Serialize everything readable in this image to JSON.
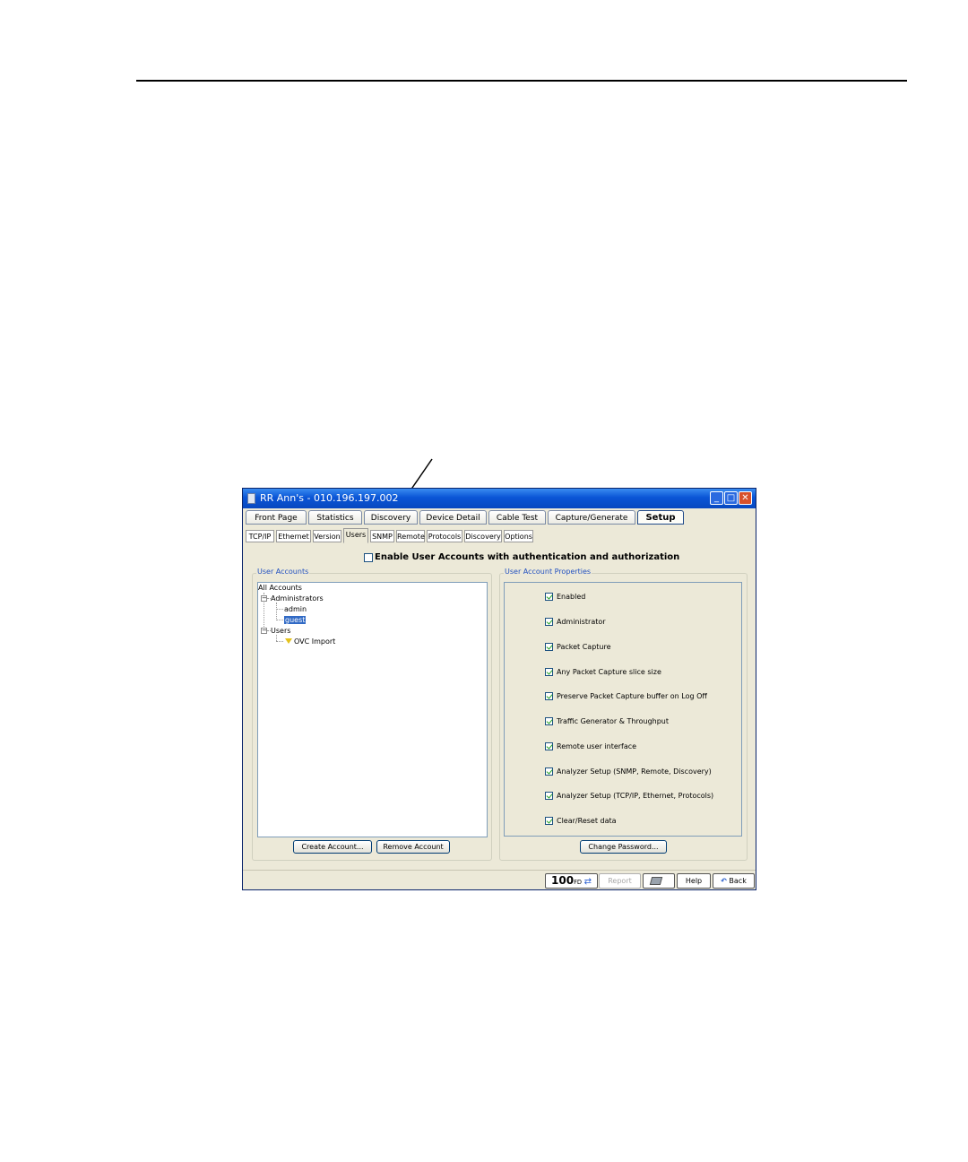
{
  "window": {
    "title": "RR Ann's - 010.196.197.002",
    "minimize_label": "_",
    "maximize_label": "□",
    "close_label": "✕"
  },
  "main_tabs": [
    {
      "label": "Front Page"
    },
    {
      "label": "Statistics"
    },
    {
      "label": "Discovery"
    },
    {
      "label": "Device Detail"
    },
    {
      "label": "Cable Test"
    },
    {
      "label": "Capture/Generate"
    },
    {
      "label": "Setup",
      "active": true
    }
  ],
  "sub_tabs": [
    {
      "label": "TCP/IP"
    },
    {
      "label": "Ethernet"
    },
    {
      "label": "Version"
    },
    {
      "label": "Users",
      "active": true
    },
    {
      "label": "SNMP"
    },
    {
      "label": "Remote"
    },
    {
      "label": "Protocols"
    },
    {
      "label": "Discovery"
    },
    {
      "label": "Options"
    }
  ],
  "enable_accounts": {
    "label": "Enable User Accounts with authentication and authorization",
    "checked": false
  },
  "user_accounts": {
    "legend": "User Accounts",
    "tree": {
      "root": "All Accounts",
      "administrators": "Administrators",
      "admin": "admin",
      "guest": "guest",
      "users": "Users",
      "ovc_import": "OVC Import"
    },
    "create_button": "Create Account...",
    "remove_button": "Remove Account"
  },
  "properties": {
    "legend": "User Account Properties",
    "items": [
      {
        "label": "Enabled",
        "checked": true
      },
      {
        "label": "Administrator",
        "checked": true
      },
      {
        "label": "Packet Capture",
        "checked": true
      },
      {
        "label": "Any Packet Capture slice size",
        "checked": true
      },
      {
        "label": "Preserve Packet Capture buffer on Log Off",
        "checked": true
      },
      {
        "label": "Traffic Generator & Throughput",
        "checked": true
      },
      {
        "label": "Remote user interface",
        "checked": true
      },
      {
        "label": "Analyzer Setup (SNMP, Remote, Discovery)",
        "checked": true
      },
      {
        "label": "Analyzer Setup (TCP/IP, Ethernet, Protocols)",
        "checked": true
      },
      {
        "label": "Clear/Reset data",
        "checked": true
      }
    ],
    "change_password_button": "Change Password..."
  },
  "statusbar": {
    "speed": "100",
    "speed_unit": "FD",
    "link_arrows": "⇄",
    "report": "Report",
    "help": "Help",
    "back": "Back",
    "back_arrow": "↶"
  }
}
